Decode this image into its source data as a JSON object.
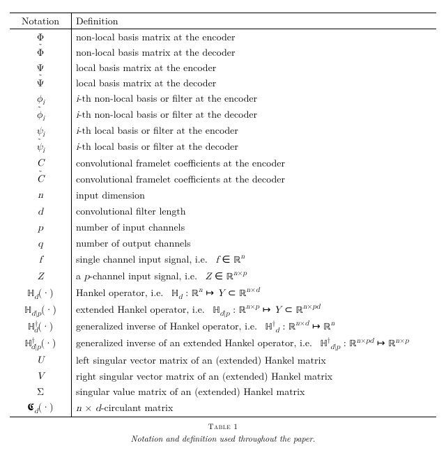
{
  "table": {
    "header": {
      "c1": "Notation",
      "c2": "Definition"
    },
    "caption_number": "Table 1",
    "caption_text": "Notation and definition used throughout the paper.",
    "rows": [
      {
        "notation": "Φ",
        "def": "non-local basis matrix at the encoder"
      },
      {
        "notation": "Φ̃",
        "def": "non-local basis matrix at the decoder"
      },
      {
        "notation": "Ψ",
        "def": "local basis matrix at the encoder"
      },
      {
        "notation": "Ψ̃",
        "def": "local basis matrix at the decoder"
      },
      {
        "notation": "φᵢ",
        "def_html": "<span class='sym'>i</span>-th non-local basis or filter at the encoder"
      },
      {
        "notation": "φ̃ᵢ",
        "def_html": "<span class='sym'>i</span>-th non-local basis or filter at the decoder"
      },
      {
        "notation": "ψᵢ",
        "def_html": "<span class='sym'>i</span>-th local basis or filter at the encoder"
      },
      {
        "notation": "ψ̃ᵢ",
        "def_html": "<span class='sym'>i</span>-th local basis or filter at the decoder"
      },
      {
        "notation": "C",
        "def": "convolutional framelet coefficients at the encoder"
      },
      {
        "notation": "C̃",
        "def": "convolutional framelet coefficients at the decoder"
      },
      {
        "notation": "n",
        "def": "input dimension"
      },
      {
        "notation": "d",
        "def": "convolutional filter length"
      },
      {
        "notation": "p",
        "def": "number of input channels"
      },
      {
        "notation": "q",
        "def": "number of output channels"
      },
      {
        "notation": "f",
        "def_html": "single channel input signal, i.e. &nbsp;<span class='sym'>f</span> ∈ <span class='bb'>ℝ</span><sup><span class='sym'>n</span></sup>"
      },
      {
        "notation": "Z",
        "def_html": "a <span class='sym'>p</span>-channel input signal, i.e. &nbsp;<span class='sym'>Z</span> ∈ <span class='bb'>ℝ</span><sup><span class='sym'>n</span>×<span class='sym'>p</span></sup>"
      },
      {
        "notation": "ℍ_d(·)",
        "def_html": "Hankel operator, i.e. &nbsp;<span class='bb'>ℍ</span><sub><span class='sym'>d</span></sub> : <span class='bb'>ℝ</span><sup><span class='sym'>n</span></sup> ↦ <span class='sym'>Y</span> ⊂ <span class='bb'>ℝ</span><sup><span class='sym'>n</span>×<span class='sym'>d</span></sup>"
      },
      {
        "notation": "ℍ_{d|p}(·)",
        "def_html": "extended Hankel operator, i.e. &nbsp;<span class='bb'>ℍ</span><sub><span class='sym'>d</span>|<span class='sym'>p</span></sub> : <span class='bb'>ℝ</span><sup><span class='sym'>n</span>×<span class='sym'>p</span></sup> ↦ <span class='sym'>Y</span> ⊂ <span class='bb'>ℝ</span><sup><span class='sym'>n</span>×<span class='sym'>pd</span></sup>"
      },
      {
        "notation": "ℍ_d†(·)",
        "def_html": "generalized inverse of Hankel operator, i.e. &nbsp;<span class='bb'>ℍ</span><sup>†</sup><sub><span class='sym'>d</span></sub> : <span class='bb'>ℝ</span><sup><span class='sym'>n</span>×<span class='sym'>d</span></sup> ↦ <span class='bb'>ℝ</span><sup><span class='sym'>n</span></sup>"
      },
      {
        "notation": "ℍ_{d|p}†(·)",
        "def_html": "generalized inverse of an extended Hankel operator, i.e. &nbsp;<span class='bb'>ℍ</span><sup>†</sup><sub><span class='sym'>d</span>|<span class='sym'>p</span></sub> : <span class='bb'>ℝ</span><sup><span class='sym'>n</span>×<span class='sym'>pd</span></sup> ↦ <span class='bb'>ℝ</span><sup><span class='sym'>n</span>×<span class='sym'>p</span></sup>"
      },
      {
        "notation": "U",
        "def": "left singular vector matrix of an (extended) Hankel matrix"
      },
      {
        "notation": "V",
        "def": "right singular vector matrix of an (extended) Hankel matrix"
      },
      {
        "notation": "Σ",
        "def": "singular value matrix of an (extended) Hankel matrix"
      },
      {
        "notation": "𝕮_d(·)",
        "def_html": "<span class='sym'>n</span> × <span class='sym'>d</span>-circulant matrix"
      }
    ]
  },
  "chart_data": {
    "type": "table",
    "title": "Notation and definition used throughout the paper.",
    "columns": [
      "Notation",
      "Definition"
    ],
    "rows": [
      [
        "Φ",
        "non-local basis matrix at the encoder"
      ],
      [
        "Φ̃",
        "non-local basis matrix at the decoder"
      ],
      [
        "Ψ",
        "local basis matrix at the encoder"
      ],
      [
        "Ψ̃",
        "local basis matrix at the decoder"
      ],
      [
        "φ_i",
        "i-th non-local basis or filter at the encoder"
      ],
      [
        "φ̃_i",
        "i-th non-local basis or filter at the decoder"
      ],
      [
        "ψ_i",
        "i-th local basis or filter at the encoder"
      ],
      [
        "ψ̃_i",
        "i-th local basis or filter at the decoder"
      ],
      [
        "C",
        "convolutional framelet coefficients at the encoder"
      ],
      [
        "C̃",
        "convolutional framelet coefficients at the decoder"
      ],
      [
        "n",
        "input dimension"
      ],
      [
        "d",
        "convolutional filter length"
      ],
      [
        "p",
        "number of input channels"
      ],
      [
        "q",
        "number of output channels"
      ],
      [
        "f",
        "single channel input signal, i.e. f ∈ ℝ^n"
      ],
      [
        "Z",
        "a p-channel input signal, i.e. Z ∈ ℝ^{n×p}"
      ],
      [
        "ℍ_d(·)",
        "Hankel operator, i.e. ℍ_d : ℝ^n ↦ Y ⊂ ℝ^{n×d}"
      ],
      [
        "ℍ_{d|p}(·)",
        "extended Hankel operator, i.e. ℍ_{d|p} : ℝ^{n×p} ↦ Y ⊂ ℝ^{n×pd}"
      ],
      [
        "ℍ_d^†(·)",
        "generalized inverse of Hankel operator, i.e. ℍ_d^† : ℝ^{n×d} ↦ ℝ^n"
      ],
      [
        "ℍ_{d|p}^†(·)",
        "generalized inverse of an extended Hankel operator, i.e. ℍ_{d|p}^† : ℝ^{n×pd} ↦ ℝ^{n×p}"
      ],
      [
        "U",
        "left singular vector matrix of an (extended) Hankel matrix"
      ],
      [
        "V",
        "right singular vector matrix of an (extended) Hankel matrix"
      ],
      [
        "Σ",
        "singular value matrix of an (extended) Hankel matrix"
      ],
      [
        "𝕮_d(·)",
        "n × d-circulant matrix"
      ]
    ]
  }
}
